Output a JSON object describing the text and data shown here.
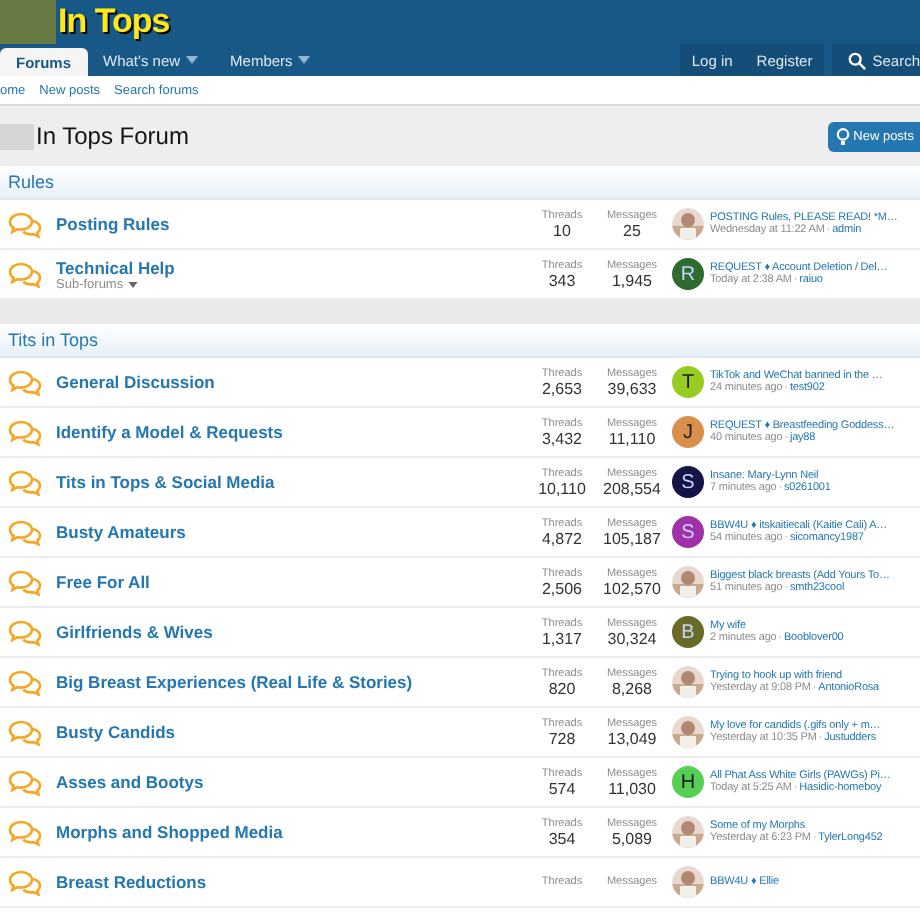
{
  "header": {
    "logo": "In Tops"
  },
  "nav": {
    "tabs": [
      {
        "label": "Forums",
        "selected": true,
        "dropdown": false
      },
      {
        "label": "What's new",
        "selected": false,
        "dropdown": true
      },
      {
        "label": "Members",
        "selected": false,
        "dropdown": true
      }
    ],
    "account": [
      "Log in",
      "Register"
    ],
    "search": "Search"
  },
  "breadcrumbs": [
    "ome",
    "New posts",
    "Search forums"
  ],
  "page": {
    "title": "In Tops Forum",
    "button": "New posts"
  },
  "sections": [
    {
      "title": "Rules",
      "forums": [
        {
          "name": "Posting Rules",
          "threads_label": "Threads",
          "threads": "10",
          "messages_label": "Messages",
          "messages": "25",
          "latest": {
            "title": "POSTING Rules, PLEASE READ! *M…",
            "time": "Wednesday at 11:22 AM",
            "sep": "·",
            "user": "admin"
          }
        },
        {
          "name": "Technical Help",
          "subforums": "Sub-forums",
          "threads_label": "Threads",
          "threads": "343",
          "messages_label": "Messages",
          "messages": "1,945",
          "avatar": {
            "kind": "letter",
            "letter": "R",
            "color": "#2e6b2e"
          },
          "latest": {
            "title": "REQUEST ♦ Account Deletion / Del…",
            "time": "Today at 2:38 AM",
            "sep": "·",
            "user": "raiuo"
          }
        }
      ]
    },
    {
      "title": "Tits in Tops",
      "forums": [
        {
          "name": "General Discussion",
          "threads_label": "Threads",
          "threads": "2,653",
          "messages_label": "Messages",
          "messages": "39,633",
          "avatar": {
            "kind": "letter",
            "letter": "T",
            "color": "#99cc22"
          },
          "latest": {
            "title": "TikTok and WeChat banned in the …",
            "time": "24 minutes ago",
            "sep": "·",
            "user": "test902"
          }
        },
        {
          "name": "Identify a Model & Requests",
          "threads_label": "Threads",
          "threads": "3,432",
          "messages_label": "Messages",
          "messages": "11,110",
          "avatar": {
            "kind": "letter",
            "letter": "J",
            "color": "#d9904a"
          },
          "latest": {
            "title": "REQUEST ♦ Breastfeeding Goddess…",
            "time": "40 minutes ago",
            "sep": "·",
            "user": "jay88"
          }
        },
        {
          "name": "Tits in Tops & Social Media",
          "threads_label": "Threads",
          "threads": "10,110",
          "messages_label": "Messages",
          "messages": "208,554",
          "avatar": {
            "kind": "letter",
            "letter": "S",
            "color": "#141447"
          },
          "latest": {
            "title": "Insane: Mary-Lynn Neil",
            "time": "7 minutes ago",
            "sep": "·",
            "user": "s0261001"
          }
        },
        {
          "name": "Busty Amateurs",
          "threads_label": "Threads",
          "threads": "4,872",
          "messages_label": "Messages",
          "messages": "105,187",
          "avatar": {
            "kind": "letter",
            "letter": "S",
            "color": "#a030a8"
          },
          "latest": {
            "title": "BBW4U ♦ itskaitiecali (Kaitie Cali) A…",
            "time": "54 minutes ago",
            "sep": "·",
            "user": "sicomancy1987"
          }
        },
        {
          "name": "Free For All",
          "threads_label": "Threads",
          "threads": "2,506",
          "messages_label": "Messages",
          "messages": "102,570",
          "latest": {
            "title": "Biggest black breasts (Add Yours To…",
            "time": "51 minutes ago",
            "sep": "·",
            "user": "smth23cool"
          }
        },
        {
          "name": "Girlfriends & Wives",
          "threads_label": "Threads",
          "threads": "1,317",
          "messages_label": "Messages",
          "messages": "30,324",
          "avatar": {
            "kind": "letter",
            "letter": "B",
            "color": "#6b6b28"
          },
          "latest": {
            "title": "My wife",
            "time": "2 minutes ago",
            "sep": "·",
            "user": "Booblover00"
          }
        },
        {
          "name": "Big Breast Experiences (Real Life & Stories)",
          "threads_label": "Threads",
          "threads": "820",
          "messages_label": "Messages",
          "messages": "8,268",
          "latest": {
            "title": "Trying to hook up with friend",
            "time": "Yesterday at 9:08 PM",
            "sep": "·",
            "user": "AntonioRosa"
          }
        },
        {
          "name": "Busty Candids",
          "threads_label": "Threads",
          "threads": "728",
          "messages_label": "Messages",
          "messages": "13,049",
          "latest": {
            "title": "My love for candids (.gifs only + m…",
            "time": "Yesterday at 10:35 PM",
            "sep": "·",
            "user": "Justudders"
          }
        },
        {
          "name": "Asses and Bootys",
          "threads_label": "Threads",
          "threads": "574",
          "messages_label": "Messages",
          "messages": "11,030",
          "avatar": {
            "kind": "letter",
            "letter": "H",
            "color": "#55d055"
          },
          "latest": {
            "title": "All Phat Ass White Girls (PAWGs) Pi…",
            "time": "Today at 5:25 AM",
            "sep": "·",
            "user": "Hasidic-homeboy"
          }
        },
        {
          "name": "Morphs and Shopped Media",
          "threads_label": "Threads",
          "threads": "354",
          "messages_label": "Messages",
          "messages": "5,089",
          "latest": {
            "title": "Some of my Morphs",
            "time": "Yesterday at 6:23 PM",
            "sep": "·",
            "user": "TylerLong452"
          }
        },
        {
          "name": "Breast Reductions",
          "threads_label": "Threads",
          "messages_label": "Messages",
          "latest": {
            "title": "BBW4U ♦ Ellie"
          }
        }
      ]
    }
  ]
}
